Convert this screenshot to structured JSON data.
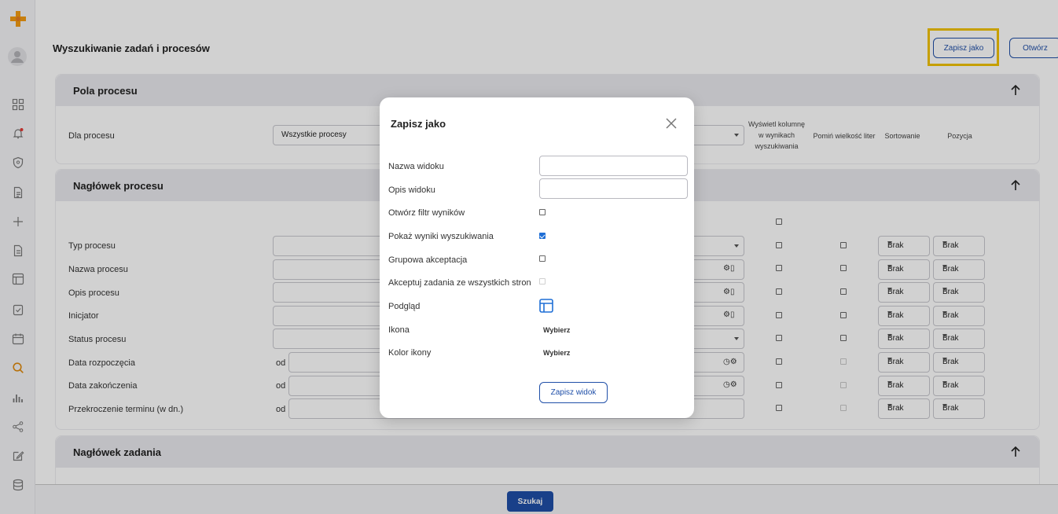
{
  "page": {
    "title": "Wyszukiwanie zadań i procesów",
    "save_as_label": "Zapisz jako",
    "open_label": "Otwórz",
    "search_label": "Szukaj"
  },
  "sidebar": {
    "icons": [
      "app-logo-icon",
      "avatar-icon",
      "grid-icon",
      "bell-icon",
      "shield-icon",
      "document-list-icon",
      "plus-icon",
      "document-icon",
      "layout-icon",
      "clipboard-check-icon",
      "calendar-icon",
      "search-icon",
      "bar-chart-icon",
      "share-icon",
      "edit-icon",
      "database-icon"
    ]
  },
  "sections": {
    "process_fields": {
      "title": "Pola procesu",
      "process_label": "Dla procesu",
      "process_value": "Wszystkie procesy",
      "col_show": "Wyświetl kolumnę w wynikach wyszukiwania",
      "col_show_lines": [
        "Wyświetl kolumnę",
        "w wynikach",
        "wyszukiwania"
      ],
      "col_ignore_case": "Pomiń wielkość liter",
      "col_sort": "Sortowanie",
      "col_position": "Pozycja"
    },
    "process_header": {
      "title": "Nagłówek procesu",
      "rows": [
        {
          "label": "Typ procesu",
          "sort": "Brak",
          "position": "Brak"
        },
        {
          "label": "Nazwa procesu",
          "sort": "Brak",
          "position": "Brak"
        },
        {
          "label": "Opis procesu",
          "sort": "Brak",
          "position": "Brak"
        },
        {
          "label": "Inicjator",
          "sort": "Brak",
          "position": "Brak"
        },
        {
          "label": "Status procesu",
          "sort": "Brak",
          "position": "Brak"
        },
        {
          "label": "Data rozpoczęcia",
          "sort": "Brak",
          "position": "Brak",
          "from": "od"
        },
        {
          "label": "Data zakończenia",
          "sort": "Brak",
          "position": "Brak",
          "from": "od"
        },
        {
          "label": "Przekroczenie terminu (w dn.)",
          "sort": "Brak",
          "position": "Brak",
          "from": "od"
        }
      ]
    },
    "task_header": {
      "title": "Nagłówek zadania"
    }
  },
  "modal": {
    "title": "Zapisz jako",
    "view_name_label": "Nazwa widoku",
    "view_name_value": "",
    "view_desc_label": "Opis widoku",
    "view_desc_value": "",
    "open_filter_label": "Otwórz filtr wyników",
    "show_results_label": "Pokaż wyniki wyszukiwania",
    "group_accept_label": "Grupowa akceptacja",
    "accept_all_label": "Akceptuj zadania ze wszystkich stron",
    "preview_label": "Podgląd",
    "icon_label": "Ikona",
    "icon_value": "Wybierz",
    "icon_color_label": "Kolor ikony",
    "icon_color_value": "Wybierz",
    "save_view_label": "Zapisz widok"
  },
  "colors": {
    "accent": "#1f4fa8",
    "highlight": "#f2c200",
    "logo": "#f39c12"
  }
}
